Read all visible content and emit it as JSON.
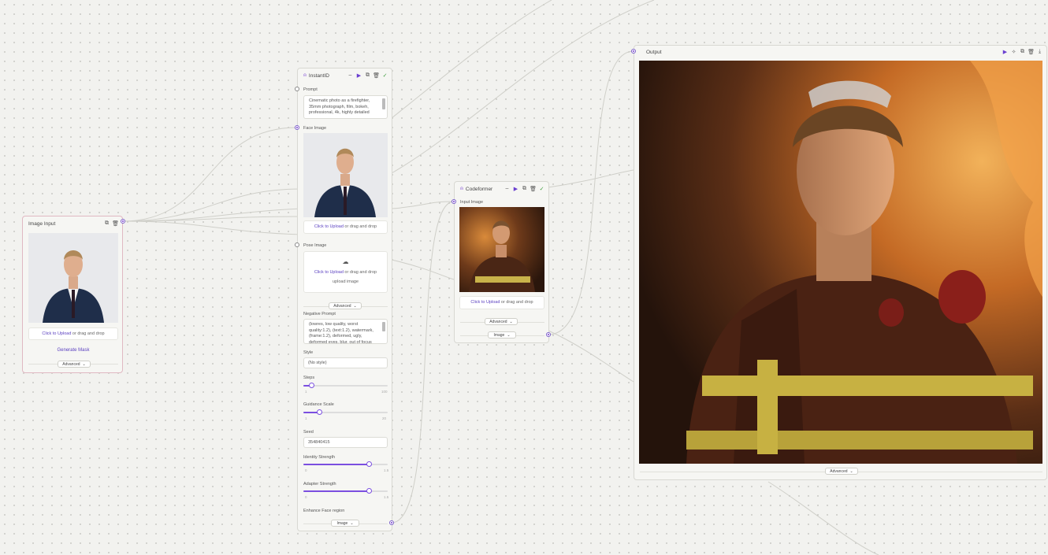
{
  "nodes": {
    "image_input": {
      "title": "Image Input",
      "upload_link": "Click to Upload",
      "upload_rest": " or drag and drop",
      "generate_mask": "Generate Mask",
      "advanced": "Advanced"
    },
    "instantid": {
      "title": "InstantID",
      "prompt_label": "Prompt",
      "prompt_value": "Cinematic photo as a firefighter, 35mm photograph, film, bokeh, professional, 4k, highly detailed",
      "face_label": "Face Image",
      "face_upload_link": "Click to Upload",
      "face_upload_rest": " or drag and drop",
      "pose_label": "Pose Image",
      "pose_upload_link": "Click to Upload",
      "pose_upload_rest": " or drag and drop",
      "pose_hint": "upload image",
      "advanced": "Advanced",
      "neg_label": "Negative Prompt",
      "neg_value": "(lowres, low quality, worst quality:1.2), (text:1.2), watermark, (frame:1.2), deformed, ugly, deformed eyes, blur, out of focus",
      "style_label": "Style",
      "style_value": "(No style)",
      "steps_label": "Steps",
      "steps_min": "1",
      "steps_max": "100",
      "steps_value": 0.1,
      "guidance_label": "Guidance Scale",
      "guidance_min": "1",
      "guidance_max": "20",
      "guidance_value": 0.19,
      "seed_label": "Seed",
      "seed_value": "354840415",
      "identity_label": "Identity Strength",
      "identity_min": "0",
      "identity_max": "1.5",
      "identity_value": 0.78,
      "adapter_label": "Adapter Strength",
      "adapter_min": "0",
      "adapter_max": "1.5",
      "adapter_value": 0.78,
      "enhance_label": "Enhance Face region",
      "output_type": "Image"
    },
    "codeformer": {
      "title": "Codeformer",
      "input_label": "Input Image",
      "upload_link": "Click to Upload",
      "upload_rest": " or drag and drop",
      "advanced": "Advanced",
      "output_type": "Image"
    },
    "output": {
      "title": "Output",
      "advanced": "Advanced"
    }
  },
  "icons": {
    "accent": "#7b4fe0",
    "link": "#5a3fc0",
    "check": "#3a9a3a"
  }
}
